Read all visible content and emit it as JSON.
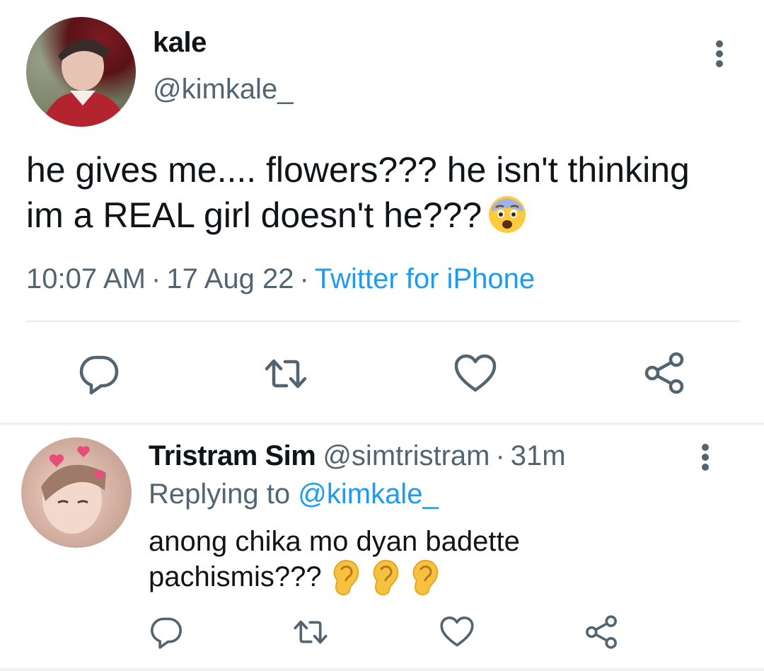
{
  "tweet": {
    "display_name": "kale",
    "handle": "@kimkale_",
    "text_line1": "he gives me.... flowers??? he isn't thinking",
    "text_line2": "im a REAL girl doesn't he???",
    "emoji": "anxious-face-emoji",
    "time": "10:07 AM",
    "date": "17 Aug 22",
    "source": "Twitter for iPhone",
    "separator": "·"
  },
  "reply": {
    "display_name": "Tristram Sim",
    "handle": "@simtristram",
    "age": "31m",
    "separator": "·",
    "replying_prefix": "Replying to",
    "replying_to": "@kimkale_",
    "text_line1": "anong chika mo dyan badette",
    "text_line2": "pachismis???",
    "emojis": [
      "ear-emoji",
      "ear-emoji",
      "ear-emoji"
    ]
  },
  "icons": {
    "reply": "reply-icon",
    "retweet": "retweet-icon",
    "like": "like-icon",
    "share": "share-icon",
    "more": "more-dots-icon"
  },
  "colors": {
    "text": "#0f1419",
    "secondary": "#536471",
    "link": "#1d9bf0"
  }
}
